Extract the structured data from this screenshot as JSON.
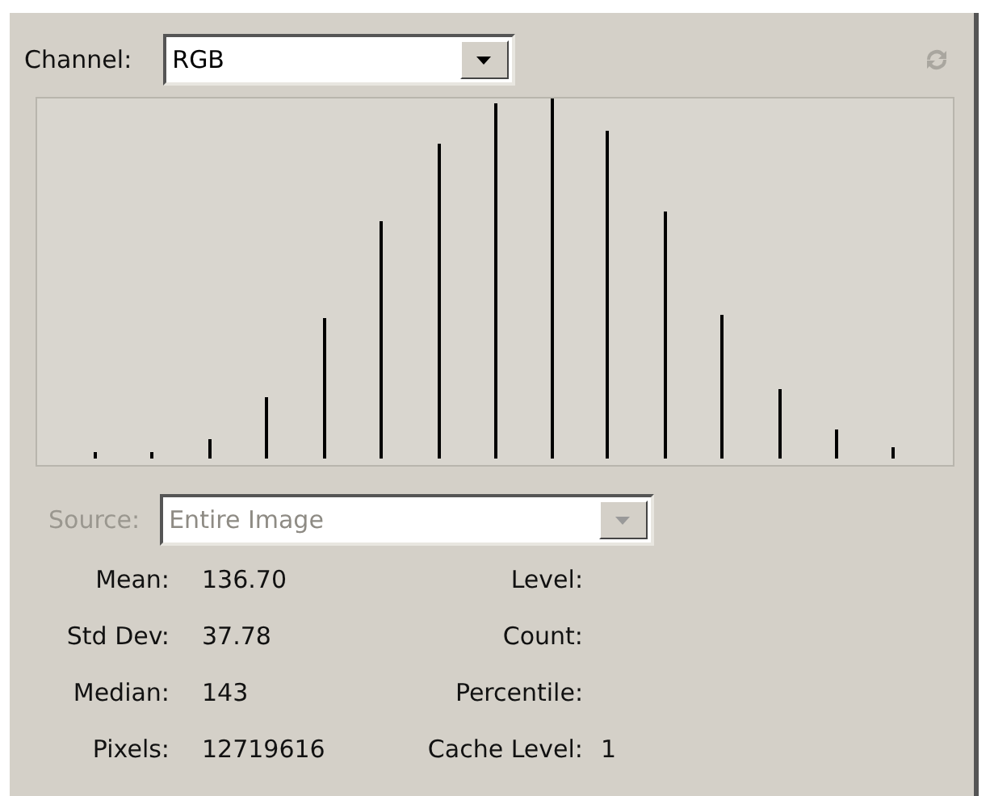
{
  "channel": {
    "label": "Channel:",
    "value": "RGB"
  },
  "source": {
    "label": "Source:",
    "value": "Entire Image",
    "disabled": true
  },
  "statistics": [
    {
      "label": "Mean:",
      "value": "136.70",
      "right_label": "Level:"
    },
    {
      "label": "Std Dev:",
      "value": "37.78",
      "right_label": "Count:"
    },
    {
      "label": "Median:",
      "value": "143",
      "right_label": "Percentile:"
    },
    {
      "label": "Pixels:",
      "value": "12719616",
      "right_label": "Cache Level:",
      "right_value": "1"
    }
  ]
}
